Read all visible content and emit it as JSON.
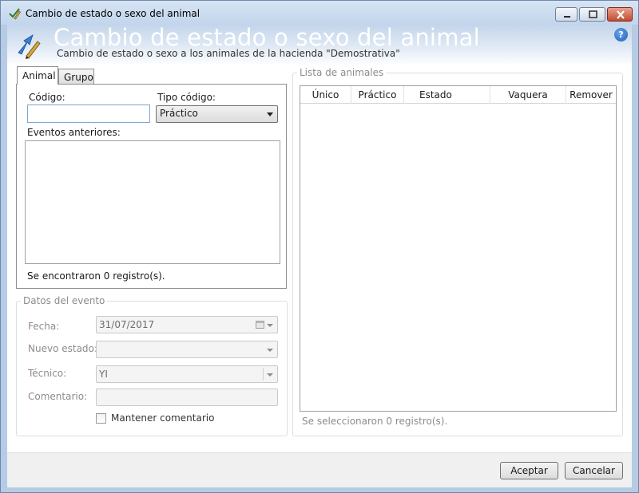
{
  "window": {
    "title": "Cambio de estado o sexo del animal",
    "icon": "pen-check-icon"
  },
  "header": {
    "title": "Cambio de estado o sexo del animal",
    "subtitle": "Cambio de estado o sexo a los animales de la hacienda \"Demostrativa\"",
    "help_label": "?"
  },
  "tabs": [
    {
      "label": "Animal",
      "active": true
    },
    {
      "label": "Grupo",
      "active": false
    }
  ],
  "animal_tab": {
    "codigo_label": "Código:",
    "codigo_value": "",
    "tipo_label": "Tipo código:",
    "tipo_value": "Práctico",
    "eventos_label": "Eventos anteriores:",
    "records_text": "Se encontraron 0 registro(s)."
  },
  "event_data": {
    "legend": "Datos del evento",
    "fecha_label": "Fecha:",
    "fecha_value": "31/07/2017",
    "estado_label": "Nuevo estado:",
    "estado_value": "",
    "tecnico_label": "Técnico:",
    "tecnico_value": "YI",
    "comentario_label": "Comentario:",
    "comentario_value": "",
    "mantener_label": "Mantener comentario",
    "mantener_checked": false
  },
  "animal_list": {
    "legend": "Lista de animales",
    "columns": [
      "Único",
      "Práctico",
      "Estado",
      "Vaquera",
      "Remover"
    ],
    "rows": [],
    "selected_text": "Se seleccionaron 0 registro(s)."
  },
  "footer": {
    "accept_label": "Aceptar",
    "cancel_label": "Cancelar"
  },
  "colors": {
    "window_frame": "#b6cbe4",
    "header_gradient_top": "#c4d5ea",
    "disabled_text": "#8c8c8c",
    "input_focus_border": "#7aa7d6"
  }
}
